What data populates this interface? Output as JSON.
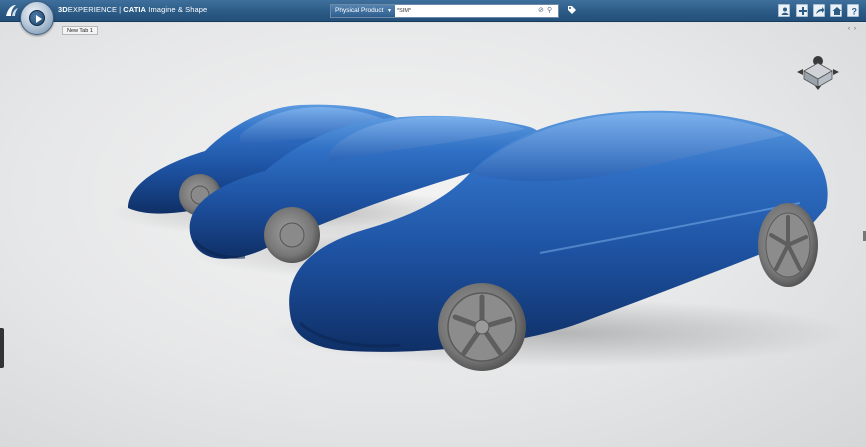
{
  "header": {
    "brand_bold": "3D",
    "brand_rest": "EXPERIENCE",
    "separator": "|",
    "app_bold": "CATIA",
    "app_rest": "Imagine & Shape"
  },
  "search": {
    "scope_label": "Physical Product",
    "value": "*SIM*"
  },
  "tabs": [
    {
      "label": "New Tab 1"
    }
  ],
  "colors": {
    "topbar": "#2c5b86",
    "car_body": "#2358a8",
    "wheel": "#7a7a7a",
    "viewport_bg": "#e6e7e8"
  },
  "icons": {
    "compass": "compass-icon",
    "brand_logo": "ds-logo-icon",
    "search_clear": "clear-icon",
    "search_go": "search-icon",
    "tag": "tag-icon",
    "profile": "user-icon",
    "add": "plus-icon",
    "share": "share-icon",
    "help": "home-icon",
    "more": "help-icon",
    "navigation_cube": "view-cube-icon"
  }
}
